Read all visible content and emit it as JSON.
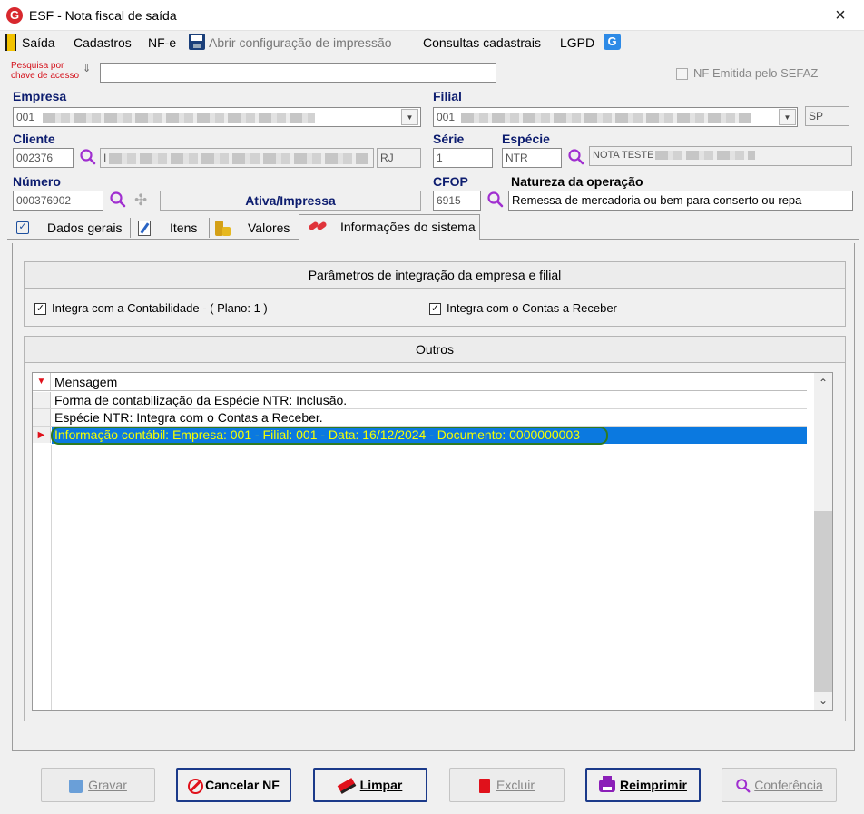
{
  "window": {
    "title": "ESF - Nota fiscal de saída",
    "logo": "G",
    "close": "×"
  },
  "menu": {
    "saida": "Saída",
    "cadastros": "Cadastros",
    "nfe": "NF-e",
    "abrir_config": "Abrir configuração de impressão",
    "consultas": "Consultas cadastrais",
    "lgpd": "LGPD"
  },
  "search": {
    "label_line1": "Pesquisa por",
    "label_line2": "chave de acesso",
    "value": ""
  },
  "nf_emitida": {
    "label": "NF Emitida pelo SEFAZ",
    "checked": false
  },
  "empresa": {
    "label": "Empresa",
    "code": "001"
  },
  "filial": {
    "label": "Filial",
    "code": "001",
    "uf": "SP"
  },
  "cliente": {
    "label": "Cliente",
    "code": "002376",
    "name_prefix": "I",
    "uf": "RJ"
  },
  "serie": {
    "label": "Série",
    "value": "1"
  },
  "especie": {
    "label": "Espécie",
    "code": "NTR",
    "desc": "NOTA TESTE"
  },
  "numero": {
    "label": "Número",
    "value": "000376902",
    "status": "Ativa/Impressa"
  },
  "cfop": {
    "label": "CFOP",
    "value": "6915"
  },
  "natureza": {
    "label": "Natureza da operação",
    "value": "Remessa de mercadoria ou bem para conserto ou repa"
  },
  "tabs": [
    {
      "label": "Dados gerais",
      "icon": "checkbox-icon"
    },
    {
      "label": "Itens",
      "icon": "edit-document-icon"
    },
    {
      "label": "Valores",
      "icon": "coins-icon"
    },
    {
      "label": "Informações do sistema",
      "icon": "pills-icon"
    }
  ],
  "integration": {
    "title": "Parâmetros de integração da empresa e filial",
    "contabilidade": "Integra com a Contabilidade - ( Plano: 1 )",
    "contas_receber": "Integra com o Contas a Receber"
  },
  "outros": {
    "title": "Outros",
    "column": "Mensagem",
    "rows": [
      "Forma de contabilização da Espécie NTR: Inclusão.",
      "Espécie NTR: Integra com o Contas a Receber.",
      "Informação contábil: Empresa: 001 - Filial: 001 - Data: 16/12/2024 - Documento: 0000000003"
    ]
  },
  "buttons": {
    "gravar": "Gravar",
    "cancelar": "Cancelar NF",
    "limpar": "Limpar",
    "excluir": "Excluir",
    "reimprimir": "Reimprimir",
    "conferencia": "Conferência"
  },
  "colors": {
    "label_blue": "#0d1d6f",
    "selection_blue": "#0078d7",
    "highlight_green": "#2f7a1f",
    "brand_red": "#d8282e"
  }
}
